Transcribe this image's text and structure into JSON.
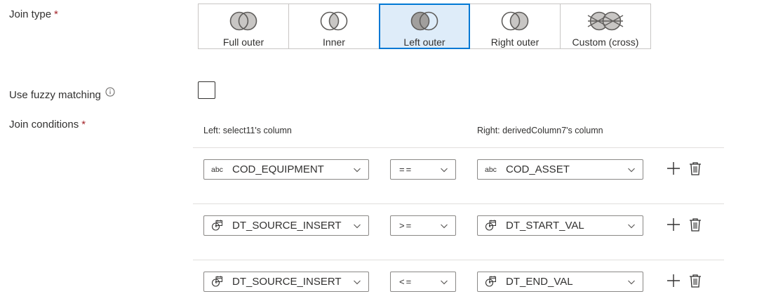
{
  "join_type": {
    "label": "Join type",
    "required_mark": "*",
    "options": [
      {
        "label": "Full outer",
        "icon": "full-outer-join-icon"
      },
      {
        "label": "Inner",
        "icon": "inner-join-icon"
      },
      {
        "label": "Left outer",
        "icon": "left-outer-join-icon"
      },
      {
        "label": "Right outer",
        "icon": "right-outer-join-icon"
      },
      {
        "label": "Custom (cross)",
        "icon": "custom-cross-join-icon"
      }
    ],
    "selected": "Left outer"
  },
  "fuzzy": {
    "label": "Use fuzzy matching",
    "checked": false
  },
  "join_conditions": {
    "label": "Join conditions",
    "required_mark": "*",
    "left_header": "Left: select11's column",
    "right_header": "Right: derivedColumn7's column",
    "rows": [
      {
        "left_type": "abc",
        "left": "COD_EQUIPMENT",
        "op": "==",
        "right_type": "abc",
        "right": "COD_ASSET"
      },
      {
        "left_type": "datetime-icon",
        "left": "DT_SOURCE_INSERT",
        "op": ">=",
        "right_type": "datetime-icon",
        "right": "DT_START_VAL"
      },
      {
        "left_type": "datetime-icon",
        "left": "DT_SOURCE_INSERT",
        "op": "<=",
        "right_type": "datetime-icon",
        "right": "DT_END_VAL"
      }
    ]
  },
  "colors": {
    "accent": "#0078d4",
    "selected_bg": "#deecf9",
    "required": "#a4262c"
  }
}
